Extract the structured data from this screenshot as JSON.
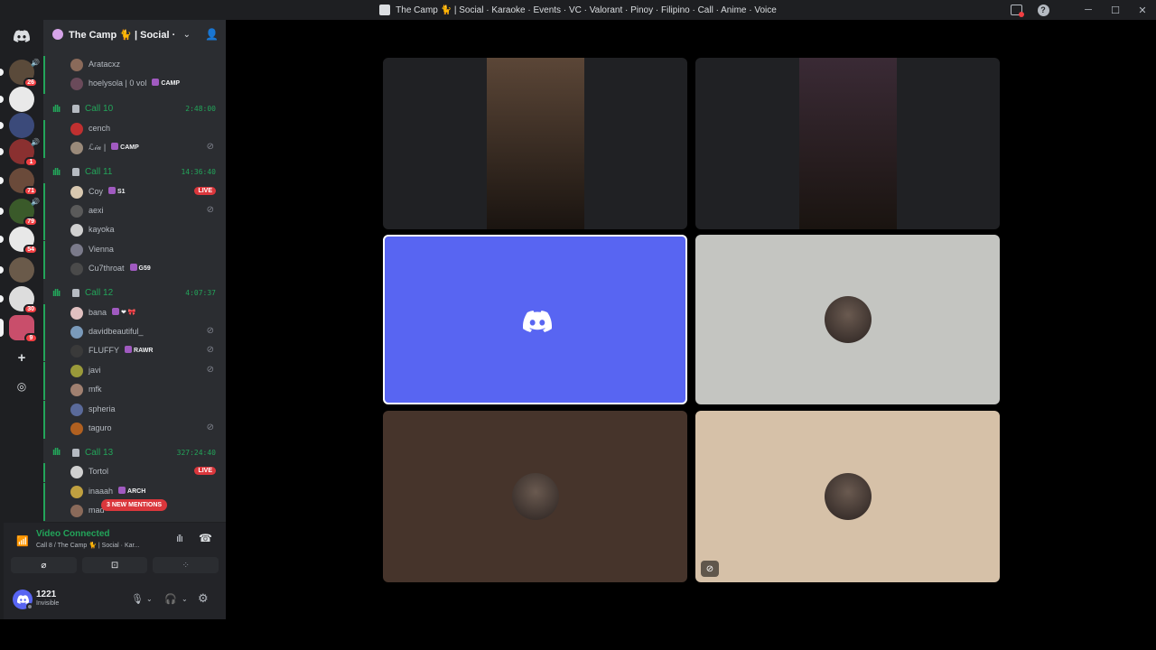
{
  "window": {
    "title": "The Camp 🐈 | Social · Karaoke · Events · VC · Valorant · Pinoy · Filipino · Call · Anime · Voice",
    "controls": [
      "minimize",
      "maximize",
      "close"
    ]
  },
  "colors": {
    "background": "#000000",
    "rail": "#1e1f22",
    "sidebar": "#2b2d31",
    "voice_green": "#23a55a",
    "blurple": "#5865f2",
    "live_red": "#da373c"
  },
  "rail": {
    "servers": [
      {
        "icon": "server-icon-1",
        "badge": "26",
        "voice": true
      },
      {
        "icon": "server-icon-2",
        "badge": "",
        "voice": false
      },
      {
        "icon": "server-icon-3",
        "badge": "",
        "voice": false
      },
      {
        "icon": "server-icon-4",
        "badge": "1",
        "voice": true
      },
      {
        "icon": "server-icon-5",
        "badge": "71",
        "voice": false
      },
      {
        "icon": "server-icon-6",
        "badge": "79",
        "voice": true
      },
      {
        "icon": "server-icon-7",
        "badge": "54",
        "voice": false
      },
      {
        "icon": "server-icon-8",
        "badge": "",
        "voice": false
      },
      {
        "icon": "server-icon-9",
        "badge": "30",
        "voice": false
      },
      {
        "icon": "server-icon-10",
        "badge": "9",
        "voice": false
      }
    ]
  },
  "guild": {
    "name": "The Camp 🐈 | Social · ..."
  },
  "channels": {
    "pre_users": [
      {
        "name": "Aratacxz",
        "tag": ""
      },
      {
        "name": "hoelysola | 0 vol",
        "tag": "CAMP"
      }
    ],
    "calls": [
      {
        "name": "Call 10",
        "time": "2:48:00",
        "users": [
          {
            "name": "cench",
            "tag": "",
            "live": false,
            "nocam": false
          },
          {
            "name": "ℒ𝒾𝒶 |",
            "tag": "CAMP",
            "live": false,
            "nocam": true
          }
        ]
      },
      {
        "name": "Call 11",
        "time": "14:36:40",
        "users": [
          {
            "name": "Coy",
            "tag": "S1",
            "live": true,
            "nocam": false
          },
          {
            "name": "aexi",
            "tag": "",
            "live": false,
            "nocam": true
          },
          {
            "name": "kayoka",
            "tag": "",
            "live": false,
            "nocam": false
          },
          {
            "name": "Vienna",
            "tag": "",
            "live": false,
            "nocam": false
          },
          {
            "name": "Cu7throat",
            "tag": "G59",
            "live": false,
            "nocam": false
          }
        ]
      },
      {
        "name": "Call 12",
        "time": "4:07:37",
        "users": [
          {
            "name": "bana",
            "tag": "❤ 🎀",
            "live": false,
            "nocam": false
          },
          {
            "name": "davidbeautiful_",
            "tag": "",
            "live": false,
            "nocam": true
          },
          {
            "name": "FLUFFY",
            "tag": "RAWR",
            "live": false,
            "nocam": true
          },
          {
            "name": "javi",
            "tag": "",
            "live": false,
            "nocam": true
          },
          {
            "name": "mfk",
            "tag": "",
            "live": false,
            "nocam": false
          },
          {
            "name": "spheria",
            "tag": "",
            "live": false,
            "nocam": false
          },
          {
            "name": "taguro",
            "tag": "",
            "live": false,
            "nocam": true
          }
        ]
      },
      {
        "name": "Call 13",
        "time": "327:24:40",
        "users": [
          {
            "name": "Tortol",
            "tag": "",
            "live": true,
            "nocam": false
          },
          {
            "name": "inaaah",
            "tag": "ARCH",
            "live": false,
            "nocam": false
          },
          {
            "name": "mad",
            "tag": "",
            "live": false,
            "nocam": false
          }
        ]
      }
    ],
    "mentions_pill": "3 NEW MENTIONS"
  },
  "voice_panel": {
    "status": "Video Connected",
    "location": "Call 8 / The Camp 🐈 | Social · Kar..."
  },
  "user_panel": {
    "name": "1221",
    "status": "Invisible"
  },
  "video_tiles": [
    {
      "kind": "camera",
      "bg": "#202124",
      "feed": "#5b4637"
    },
    {
      "kind": "camera",
      "bg": "#202124",
      "feed": "#3a2a35"
    },
    {
      "kind": "logo",
      "bg": "#5865f2"
    },
    {
      "kind": "avatar",
      "bg": "#c4c5c1"
    },
    {
      "kind": "avatar",
      "bg": "#46342b"
    },
    {
      "kind": "avatar",
      "bg": "#d6c1a8",
      "nocam": true
    }
  ]
}
